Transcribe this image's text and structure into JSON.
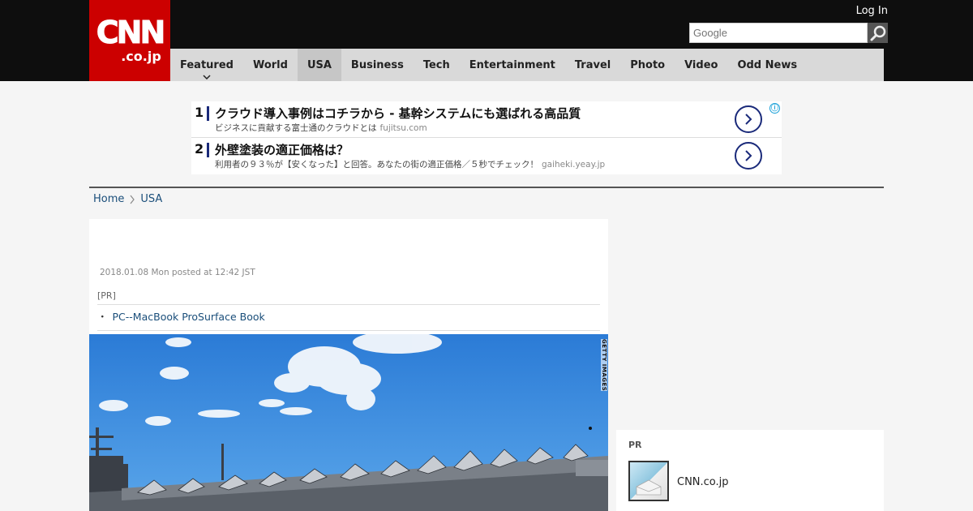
{
  "header": {
    "logo_main": "CNN",
    "logo_sub": ".co.jp",
    "login_label": "Log In",
    "search_placeholder": "Google"
  },
  "nav": {
    "items": [
      {
        "label": "Featured"
      },
      {
        "label": "World"
      },
      {
        "label": "USA"
      },
      {
        "label": "Business"
      },
      {
        "label": "Tech"
      },
      {
        "label": "Entertainment"
      },
      {
        "label": "Travel"
      },
      {
        "label": "Photo"
      },
      {
        "label": "Video"
      },
      {
        "label": "Odd News"
      }
    ],
    "active": "USA"
  },
  "ads": {
    "items": [
      {
        "num": "1",
        "title": "クラウド導入事例はコチラから - 基幹システムにも選ばれる高品質",
        "desc": "ビジネスに貢献する富士通のクラウドとは",
        "domain": "fujitsu.com"
      },
      {
        "num": "2",
        "title": "外壁塗装の適正価格は？",
        "desc": "利用者の９３％が【安くなった】と回答。あなたの街の適正価格／５秒でチェック！",
        "domain": "gaiheki.yeay.jp"
      }
    ],
    "info_icon": "ⓘ"
  },
  "breadcrumb": {
    "home": "Home",
    "current": "USA"
  },
  "article": {
    "dateline": "2018.01.08 Mon posted at 12:42 JST",
    "pr_label": "[PR]",
    "pr_link_bullet": "・",
    "pr_link": "PC--MacBook ProSurface Book",
    "photo_credit": "GETTY IMAGES"
  },
  "sidebar": {
    "pr_label": "PR",
    "pr_item_text": "CNN.co.jp"
  },
  "colors": {
    "brand_red": "#cc0000",
    "topbar": "#0e0e0e",
    "nav_bg": "#d9d9d9",
    "link_blue": "#1a4e7a",
    "ad_accent": "#1a2a7a"
  }
}
